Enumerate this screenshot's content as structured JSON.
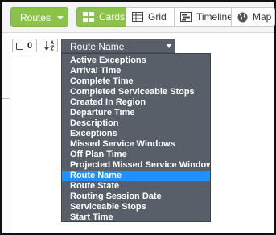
{
  "toolbar": {
    "routes_label": "Routes",
    "views": [
      {
        "label": "Cards",
        "icon": "cards-icon",
        "active": true
      },
      {
        "label": "Grid",
        "icon": "grid-icon",
        "active": false
      },
      {
        "label": "Timeline",
        "icon": "timeline-icon",
        "active": false
      },
      {
        "label": "Map",
        "icon": "globe-icon",
        "active": false
      }
    ]
  },
  "controls": {
    "selected_count": "0",
    "sort_field": "Route Name"
  },
  "sort_options": [
    "Active Exceptions",
    "Arrival Time",
    "Complete Time",
    "Completed Serviceable Stops",
    "Created In Region",
    "Departure Time",
    "Description",
    "Exceptions",
    "Missed Service Windows",
    "Off Plan Time",
    "Projected Missed Service Windows",
    "Route Name",
    "Route State",
    "Routing Session Date",
    "Serviceable Stops",
    "Start Time"
  ],
  "selected_option": "Route Name",
  "colors": {
    "accent_green": "#8bc34a",
    "dropdown_bg": "#595f68",
    "selected_highlight": "#1e90ff"
  }
}
